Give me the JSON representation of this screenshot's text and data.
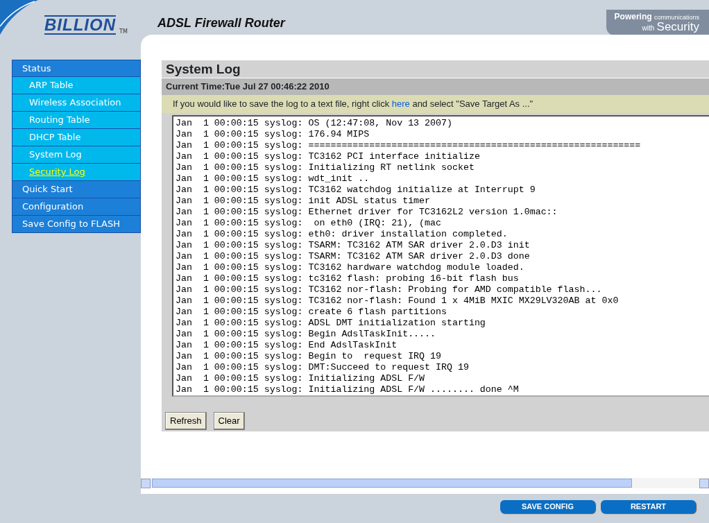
{
  "header": {
    "logo": "BILLION",
    "trademark": "TM",
    "title": "ADSL Firewall Router",
    "tagline_bold": "Powering",
    "tagline_small": "communications",
    "tagline_with": "with",
    "tagline_big": "Security"
  },
  "sidebar": {
    "items": [
      {
        "label": "Status",
        "kind": "section",
        "selected": false
      },
      {
        "label": "ARP Table",
        "kind": "sub",
        "selected": false
      },
      {
        "label": "Wireless Association",
        "kind": "sub",
        "selected": false
      },
      {
        "label": "Routing Table",
        "kind": "sub",
        "selected": false
      },
      {
        "label": "DHCP Table",
        "kind": "sub",
        "selected": false
      },
      {
        "label": "System Log",
        "kind": "sub",
        "selected": false
      },
      {
        "label": "Security Log",
        "kind": "sub",
        "selected": true
      },
      {
        "label": "Quick Start",
        "kind": "section",
        "selected": false
      },
      {
        "label": "Configuration",
        "kind": "section",
        "selected": false
      },
      {
        "label": "Save Config to FLASH",
        "kind": "section",
        "selected": false
      }
    ]
  },
  "page": {
    "title": "System Log",
    "current_time": "Current Time:Tue Jul 27 00:46:22 2010",
    "hint_before": "If you would like to save the log to a text file, right click",
    "hint_link": "here",
    "hint_after": "and select \"Save Target As ...\"",
    "log_lines": [
      "Jan  1 00:00:15 syslog: OS (12:47:08, Nov 13 2007)",
      "Jan  1 00:00:15 syslog: 176.94 MIPS",
      "Jan  1 00:00:15 syslog: ============================================================",
      "Jan  1 00:00:15 syslog: TC3162 PCI interface initialize",
      "Jan  1 00:00:15 syslog: Initializing RT netlink socket",
      "Jan  1 00:00:15 syslog: wdt_init ..",
      "Jan  1 00:00:15 syslog: TC3162 watchdog initialize at Interrupt 9",
      "Jan  1 00:00:15 syslog: init ADSL status timer",
      "Jan  1 00:00:15 syslog: Ethernet driver for TC3162L2 version 1.0mac::",
      "Jan  1 00:00:15 syslog:  on eth0 (IRQ: 21), (mac",
      "Jan  1 00:00:15 syslog: eth0: driver installation completed.",
      "Jan  1 00:00:15 syslog: TSARM: TC3162 ATM SAR driver 2.0.D3 init",
      "Jan  1 00:00:15 syslog: TSARM: TC3162 ATM SAR driver 2.0.D3 done",
      "Jan  1 00:00:15 syslog: TC3162 hardware watchdog module loaded.",
      "Jan  1 00:00:15 syslog: tc3162 flash: probing 16-bit flash bus",
      "Jan  1 00:00:15 syslog: TC3162 nor-flash: Probing for AMD compatible flash...",
      "Jan  1 00:00:15 syslog: TC3162 nor-flash: Found 1 x 4MiB MXIC MX29LV320AB at 0x0",
      "Jan  1 00:00:15 syslog: create 6 flash partitions",
      "Jan  1 00:00:15 syslog: ADSL DMT initialization starting",
      "Jan  1 00:00:15 syslog: Begin AdslTaskInit.....",
      "Jan  1 00:00:15 syslog: End AdslTaskInit",
      "Jan  1 00:00:15 syslog: Begin to  request IRQ 19",
      "Jan  1 00:00:15 syslog: DMT:Succeed to request IRQ 19",
      "Jan  1 00:00:15 syslog: Initializing ADSL F/W",
      "Jan  1 00:00:15 syslog: Initializing ADSL F/W ........ done ^M"
    ],
    "buttons": [
      "Refresh",
      "Clear"
    ]
  },
  "footer": {
    "buttons": [
      "SAVE CONFIG",
      "RESTART"
    ]
  }
}
